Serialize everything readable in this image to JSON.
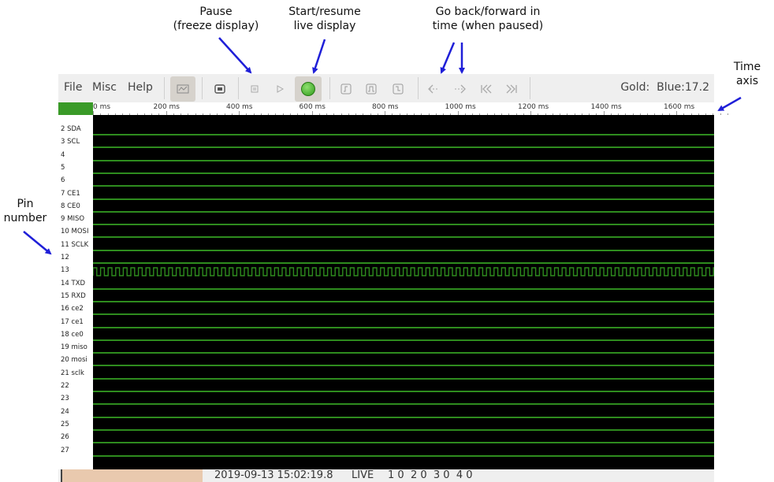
{
  "annotations": {
    "pause": [
      "Pause",
      "(freeze display)"
    ],
    "start": [
      "Start/resume",
      "live display"
    ],
    "goback": [
      "Go back/forward in",
      "time (when paused)"
    ],
    "time_axis": [
      "Time",
      "axis"
    ],
    "pin_number": [
      "Pin",
      "number"
    ]
  },
  "menu": {
    "file": "File",
    "misc": "Misc",
    "help": "Help"
  },
  "toolbar": {
    "status_right": "Gold:  Blue:17.2",
    "icons": [
      "scope-icon",
      "settings-icon",
      "pause-icon",
      "play-icon",
      "live-indicator-icon",
      "trigger-rising-icon",
      "trigger-both-icon",
      "trigger-falling-icon",
      "back-icon",
      "forward-icon",
      "go-start-icon",
      "go-end-icon"
    ]
  },
  "time_axis": {
    "labels": [
      "0 ms",
      "200 ms",
      "400 ms",
      "600 ms",
      "800 ms",
      "1000 ms",
      "1200 ms",
      "1400 ms",
      "1600 ms"
    ]
  },
  "pins": [
    "2 SDA",
    "3 SCL",
    "4",
    "5",
    "6",
    "7 CE1",
    "8 CE0",
    "9 MISO",
    "10 MOSI",
    "11 SCLK",
    "12",
    "13",
    "14 TXD",
    "15 RXD",
    "16 ce2",
    "17 ce1",
    "18 ce0",
    "19 miso",
    "20 mosi",
    "21 sclk",
    "22",
    "23",
    "24",
    "25",
    "26",
    "27"
  ],
  "statusbar": {
    "timestamp": "2019-09-13 15:02:19.8",
    "mode": "LIVE",
    "values": "1 0  2 0  3 0  4 0"
  },
  "colors": {
    "trace": "#2e8c1e",
    "plot_bg": "#000000",
    "live_green": "#3a9a28",
    "status_swatch": "#e9c9ae",
    "arrow": "#1f1fd8"
  }
}
